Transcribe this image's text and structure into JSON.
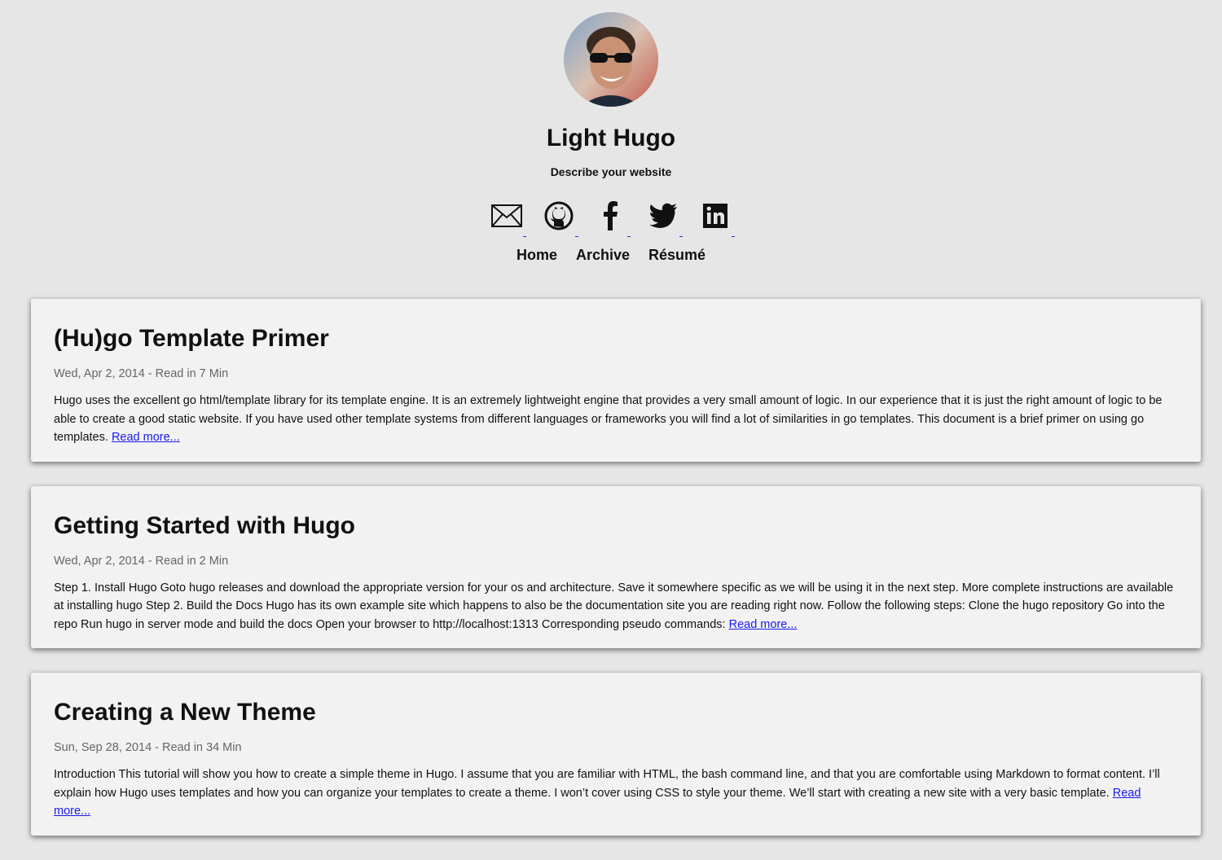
{
  "site": {
    "title": "Light Hugo",
    "description": "Describe your website"
  },
  "social": [
    {
      "icon": "mail-icon"
    },
    {
      "icon": "github-icon"
    },
    {
      "icon": "facebook-icon"
    },
    {
      "icon": "twitter-icon"
    },
    {
      "icon": "linkedin-icon"
    }
  ],
  "nav": {
    "home": "Home",
    "archive": "Archive",
    "resume": "Résumé"
  },
  "posts": [
    {
      "title": "(Hu)go Template Primer",
      "meta": "Wed, Apr 2, 2014 - Read in 7 Min",
      "summary": "Hugo uses the excellent go html/template library for its template engine. It is an extremely lightweight engine that provides a very small amount of logic. In our experience that it is just the right amount of logic to be able to create a good static website. If you have used other template systems from different languages or frameworks you will find a lot of similarities in go templates. This document is a brief primer on using go templates.",
      "read_more": "Read more..."
    },
    {
      "title": "Getting Started with Hugo",
      "meta": "Wed, Apr 2, 2014 - Read in 2 Min",
      "summary": "Step 1. Install Hugo Goto hugo releases and download the appropriate version for your os and architecture. Save it somewhere specific as we will be using it in the next step. More complete instructions are available at installing hugo Step 2. Build the Docs Hugo has its own example site which happens to also be the documentation site you are reading right now. Follow the following steps: Clone the hugo repository Go into the repo Run hugo in server mode and build the docs Open your browser to http://localhost:1313 Corresponding pseudo commands:",
      "read_more": "Read more..."
    },
    {
      "title": "Creating a New Theme",
      "meta": "Sun, Sep 28, 2014 - Read in 34 Min",
      "summary": "Introduction This tutorial will show you how to create a simple theme in Hugo. I assume that you are familiar with HTML, the bash command line, and that you are comfortable using Markdown to format content. I’ll explain how Hugo uses templates and how you can organize your templates to create a theme. I won’t cover using CSS to style your theme. We’ll start with creating a new site with a very basic template.",
      "read_more": "Read more..."
    }
  ],
  "colors": {
    "background": "#e6e6e6",
    "card": "#f2f2f2",
    "link": "#1a1aee",
    "meta": "#666666"
  }
}
